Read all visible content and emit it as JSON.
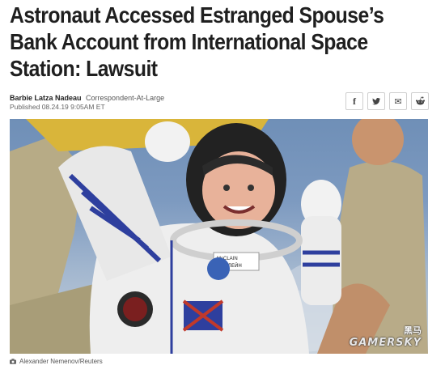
{
  "article": {
    "headline": "Astronaut Accessed Estranged Spouse’s Bank Account from International Space Station: Lawsuit",
    "author": "Barbie Latza Nadeau",
    "role": "Correspondent-At-Large",
    "published": "Published 08.24.19 9:05AM ET"
  },
  "share": {
    "facebook_glyph": "f",
    "mail_glyph": "✉"
  },
  "photo": {
    "suit_name": "McCLAIN",
    "suit_name_cyrillic": "МАКЛЕЙН",
    "credit": "Alexander Nemenov/Reuters"
  },
  "watermark": {
    "line1": "黑马",
    "line2": "GAMERSKY"
  },
  "colors": {
    "headline": "#1f1f1f",
    "suit_stripe": "#2e3f9e",
    "sky": "#7d9ac0"
  }
}
